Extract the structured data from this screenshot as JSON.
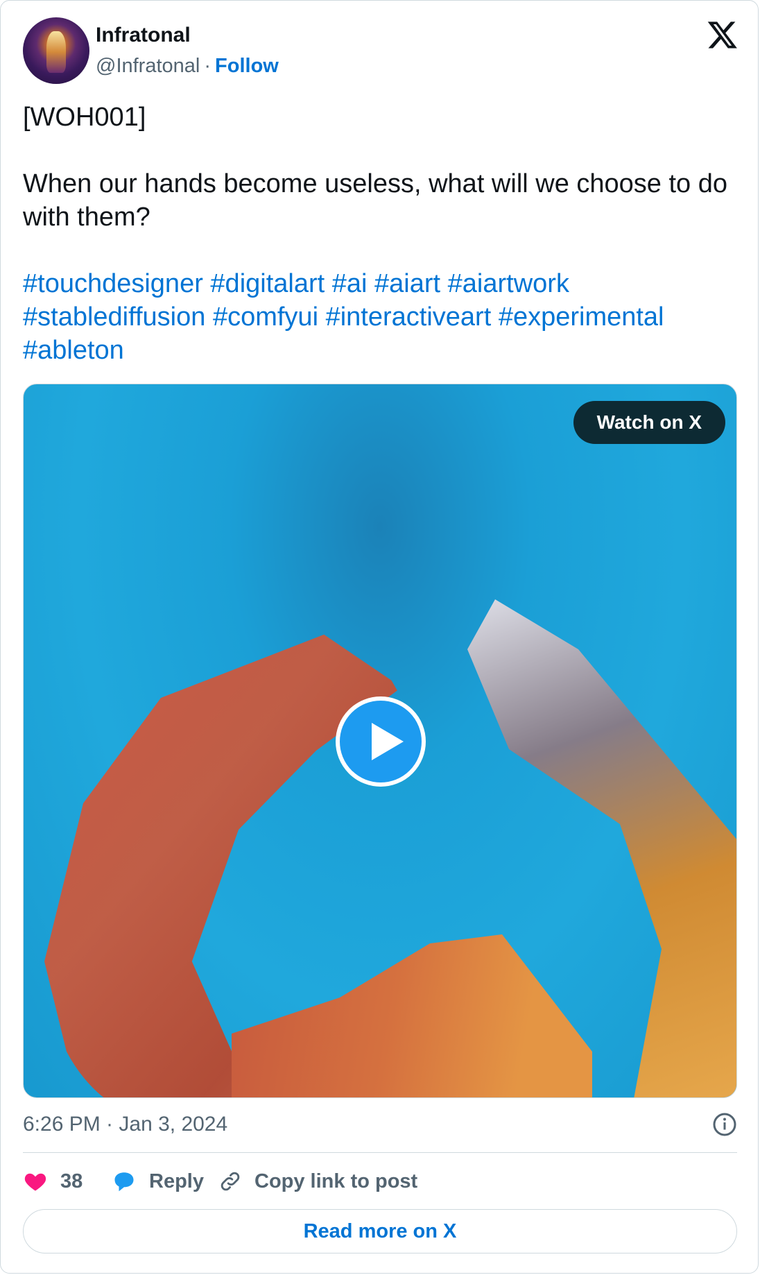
{
  "author": {
    "name": "Infratonal",
    "handle": "@Infratonal",
    "separator": "·",
    "follow_label": "Follow"
  },
  "tweet": {
    "line1": "[WOH001]",
    "line2": "When our hands become useless, what will we choose to do with them?",
    "hashtags": [
      "#touchdesigner",
      "#digitalart",
      "#ai",
      "#aiart",
      "#aiartwork",
      "#stablediffusion",
      "#comfyui",
      "#interactiveart",
      "#experimental",
      "#ableton"
    ]
  },
  "media": {
    "watch_label": "Watch on X"
  },
  "meta": {
    "timestamp": "6:26 PM · Jan 3, 2024"
  },
  "actions": {
    "likes_count": "38",
    "reply_label": "Reply",
    "copy_label": "Copy link to post"
  },
  "footer": {
    "read_more_label": "Read more on X"
  },
  "colors": {
    "link": "#0074d4",
    "like": "#f91880",
    "reply": "#1d9bf0",
    "pill": "#0d2a33"
  }
}
